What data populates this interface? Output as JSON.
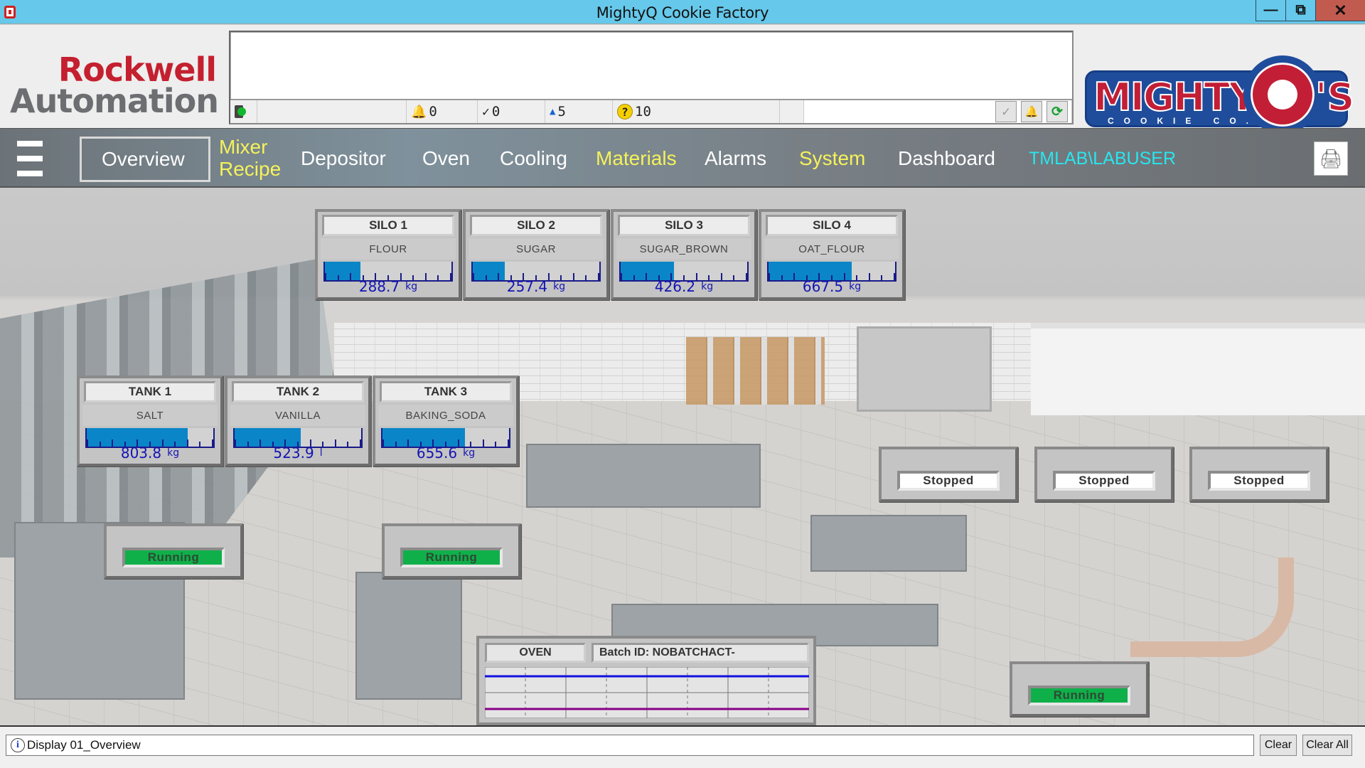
{
  "window": {
    "title": "MightyQ Cookie Factory",
    "minimize": "minimize",
    "restore": "restore",
    "close": "close"
  },
  "header": {
    "vendor_logo": {
      "line1": "Rockwell",
      "line2": "Automation"
    },
    "brand_logo": {
      "word": "MIGHTY",
      "q": "Q",
      "suffix": "'S",
      "subtitle": "COOKIE CO."
    },
    "alarm_summary": {
      "banner_text": "",
      "counts": [
        {
          "icon": "alarm-bell-icon",
          "value": "0"
        },
        {
          "icon": "acknowledged-alarm-icon",
          "value": "0"
        },
        {
          "icon": "small-bell-icon",
          "value": "5"
        },
        {
          "icon": "question-icon",
          "value": "10"
        }
      ],
      "buttons": [
        {
          "name": "acknowledge-button",
          "icon": "check-icon"
        },
        {
          "name": "silence-button",
          "icon": "bell-icon"
        },
        {
          "name": "refresh-button",
          "icon": "refresh-icon"
        }
      ]
    }
  },
  "nav": {
    "items": [
      {
        "label": "Overview",
        "color": "#ffffff",
        "active": true
      },
      {
        "label": "Mixer Recipe",
        "line1": "Mixer",
        "line2": "Recipe",
        "color": "#f5f25a"
      },
      {
        "label": "Depositor",
        "color": "#ffffff"
      },
      {
        "label": "Oven",
        "color": "#ffffff"
      },
      {
        "label": "Cooling",
        "color": "#ffffff"
      },
      {
        "label": "Materials",
        "color": "#f5f25a"
      },
      {
        "label": "Alarms",
        "color": "#ffffff"
      },
      {
        "label": "System",
        "color": "#f5f25a"
      },
      {
        "label": "Dashboard",
        "color": "#ffffff"
      }
    ],
    "user": "TMLAB\\LABUSER",
    "user_color": "#28e6ef"
  },
  "silos": [
    {
      "title": "SILO 1",
      "material": "FLOUR",
      "value": "288.7",
      "unit": "kg",
      "level": 0.28
    },
    {
      "title": "SILO 2",
      "material": "SUGAR",
      "value": "257.4",
      "unit": "kg",
      "level": 0.25
    },
    {
      "title": "SILO 3",
      "material": "SUGAR_BROWN",
      "value": "426.2",
      "unit": "kg",
      "level": 0.42
    },
    {
      "title": "SILO 4",
      "material": "OAT_FLOUR",
      "value": "667.5",
      "unit": "kg",
      "level": 0.66
    }
  ],
  "tanks": [
    {
      "title": "TANK 1",
      "material": "SALT",
      "value": "803.8",
      "unit": "kg",
      "level": 0.8
    },
    {
      "title": "TANK 2",
      "material": "VANILLA",
      "value": "523.9",
      "unit": "l",
      "level": 0.52
    },
    {
      "title": "TANK 3",
      "material": "BAKING_SODA",
      "value": "655.6",
      "unit": "kg",
      "level": 0.65
    }
  ],
  "equipment_status": [
    {
      "id": "mixer-1",
      "state": "Running"
    },
    {
      "id": "mixer-2",
      "state": "Running"
    },
    {
      "id": "line-1",
      "state": "Stopped"
    },
    {
      "id": "line-2",
      "state": "Stopped"
    },
    {
      "id": "line-3",
      "state": "Stopped"
    },
    {
      "id": "cooling",
      "state": "Running"
    }
  ],
  "status_colors": {
    "running": "#0fb04a",
    "stopped": "#ffffff",
    "gauge_fill": "#0a86c8",
    "value_text": "#1414b4"
  },
  "oven": {
    "title": "OVEN",
    "batch": "Batch ID: NOBATCHACT-",
    "trend": {
      "pens": [
        {
          "color": "#1010e0",
          "level": 0.82
        },
        {
          "color": "#880088",
          "level": 0.18
        }
      ]
    }
  },
  "statusbar": {
    "message": "Display 01_Overview",
    "clear": "Clear",
    "clear_all": "Clear All"
  }
}
